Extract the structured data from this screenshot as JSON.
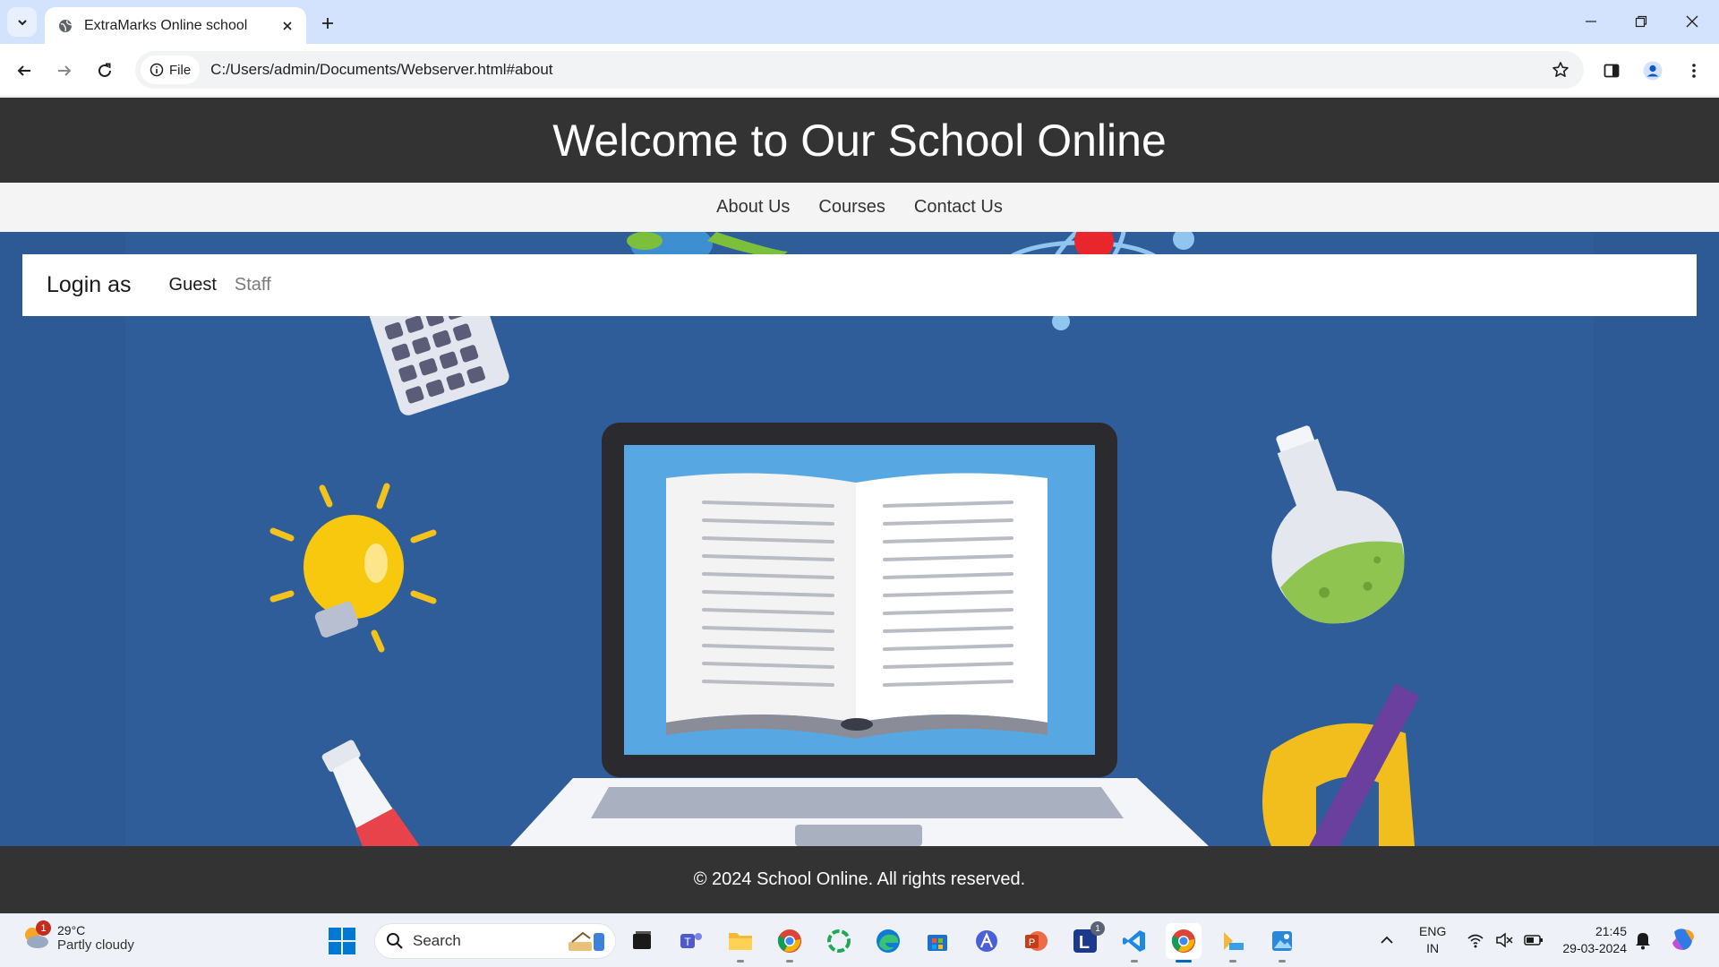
{
  "browser": {
    "tab_title": "ExtraMarks Online school",
    "address_chip": "File",
    "url": "C:/Users/admin/Documents/Webserver.html#about"
  },
  "site": {
    "header_title": "Welcome to Our School Online",
    "nav": [
      "About Us",
      "Courses",
      "Contact Us"
    ],
    "login": {
      "label": "Login as",
      "options": [
        "Guest",
        "Staff"
      ]
    },
    "footer": "© 2024 School Online. All rights reserved."
  },
  "taskbar": {
    "weather_temp": "29°C",
    "weather_condition": "Partly cloudy",
    "weather_badge": "1",
    "search_label": "Search",
    "lang_line1": "ENG",
    "lang_line2": "IN",
    "time": "21:45",
    "date": "29-03-2024",
    "l_app_badge": "1"
  },
  "colors": {
    "header_bg": "#333333",
    "nav_bg": "#f4f4f4",
    "hero_bg": "#2f5d99",
    "tabstrip_bg": "#d3e3fd"
  }
}
